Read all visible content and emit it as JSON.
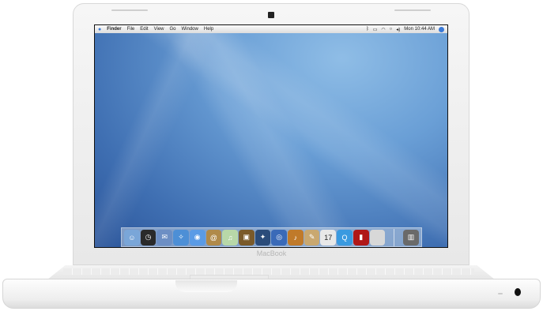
{
  "menubar": {
    "apple_icon": "apple-icon",
    "items": [
      "Finder",
      "File",
      "Edit",
      "View",
      "Go",
      "Window",
      "Help"
    ],
    "status_icons": [
      "bluetooth-icon",
      "battery-icon",
      "wifi-icon",
      "sync-icon",
      "volume-icon"
    ],
    "clock": "Mon 10:44 AM",
    "spotlight_icon": "spotlight-icon"
  },
  "dock": {
    "apps": [
      {
        "name": "finder",
        "color": "#7aa6d8",
        "glyph": "☺"
      },
      {
        "name": "dashboard",
        "color": "#2a2a2a",
        "glyph": "◷"
      },
      {
        "name": "mail",
        "color": "#6d8fc4",
        "glyph": "✉"
      },
      {
        "name": "safari",
        "color": "#4d8fd6",
        "glyph": "✧"
      },
      {
        "name": "ichat",
        "color": "#5a9be6",
        "glyph": "◉"
      },
      {
        "name": "address-book",
        "color": "#b08a4a",
        "glyph": "@"
      },
      {
        "name": "itunes",
        "color": "#b8d8a8",
        "glyph": "♫"
      },
      {
        "name": "iphoto",
        "color": "#7a5a2a",
        "glyph": "▣"
      },
      {
        "name": "imovie",
        "color": "#2b4c7a",
        "glyph": "✦"
      },
      {
        "name": "idvd",
        "color": "#3a6ab8",
        "glyph": "◎"
      },
      {
        "name": "garageband",
        "color": "#c07a2a",
        "glyph": "♪"
      },
      {
        "name": "iweb",
        "color": "#c9a870",
        "glyph": "✎"
      },
      {
        "name": "ical",
        "color": "#e8e8e8",
        "glyph": "17",
        "text": "#222"
      },
      {
        "name": "quicktime",
        "color": "#3a9ae0",
        "glyph": "Q"
      },
      {
        "name": "photo-booth",
        "color": "#b01818",
        "glyph": "▮"
      },
      {
        "name": "system-preferences",
        "color": "#d8d8d8",
        "glyph": "",
        "text": "#555"
      }
    ],
    "trash": {
      "name": "trash",
      "color": "#6a6a6a",
      "glyph": "▥"
    }
  },
  "brand": "MacBook",
  "colors": {
    "desktop": "#4f86c6",
    "menubar": "#e8e8e8",
    "body": "#f2f2f2"
  }
}
